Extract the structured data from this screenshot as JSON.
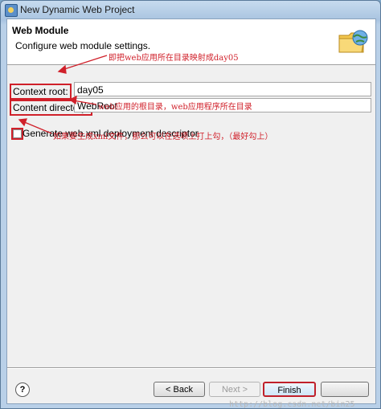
{
  "window": {
    "title": "New Dynamic Web Project",
    "icon": "web-project-icon"
  },
  "header": {
    "title": "Web Module",
    "description": "Configure web module settings.",
    "icon": "folder-globe-icon"
  },
  "form": {
    "context_root": {
      "label": "Context root:",
      "value": "day05"
    },
    "content_directory": {
      "label": "Content directory:",
      "value": "WebRoot"
    },
    "generate_descriptor": {
      "label": "Generate web.xml deployment descriptor",
      "checked": false
    }
  },
  "annotations": {
    "context_root_note": "即把web应用所在目录映射成day05",
    "content_directory_note": "web应用的根目录，web应用程序所在目录",
    "descriptor_note": "如果要生成xml文件，那么可以在选项上打上勾，（最好勾上）"
  },
  "buttons": {
    "help": "?",
    "back": "< Back",
    "next": "Next >",
    "finish": "Finish"
  },
  "watermark": "http://blog.csdn.net/bin25",
  "colors": {
    "annotation": "#d0202a",
    "finish_border": "#c0202a"
  }
}
